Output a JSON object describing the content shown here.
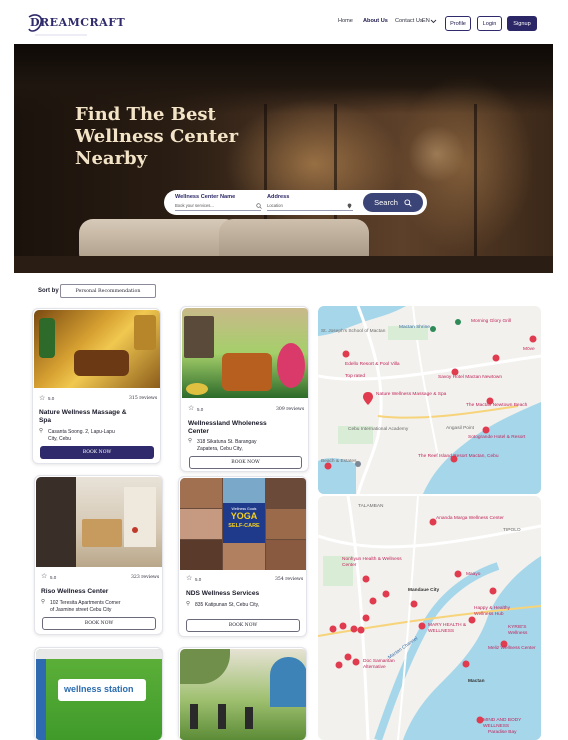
{
  "brand": {
    "name": "DREAMCRAFT"
  },
  "nav": {
    "home": "Home",
    "about": "About Us",
    "contact": "Contact Us",
    "lang": "EN"
  },
  "auth": {
    "profile": "Profile",
    "login": "Login",
    "signup": "Signup"
  },
  "hero": {
    "title_line1": "Find The Best",
    "title_line2": "Wellness Center",
    "title_line3": "Nearby"
  },
  "search": {
    "name_label": "Wellness Center Name",
    "name_placeholder": "Book your services...",
    "address_label": "Address",
    "address_placeholder": "Location",
    "button": "Search"
  },
  "sort": {
    "label": "Sort by",
    "value": "Personal Recommendation"
  },
  "cards": [
    {
      "rating": "5.0",
      "reviews": "315 reviews",
      "name_l1": "Nature Wellness Massage &",
      "name_l2": "Spa",
      "addr_l1": "Casanta Soong. 2, Lapu-Lapu",
      "addr_l2": "City, Cebu",
      "book": "BOOK NOW"
    },
    {
      "rating": "5.0",
      "reviews": "309 reviews",
      "name_l1": "Wellnessland Wholeness",
      "name_l2": "Center",
      "addr_l1": "318 Sikatuna St. Barangay",
      "addr_l2": "Zapatera, Cebu City,",
      "book": "BOOK NOW"
    },
    {
      "rating": "5.0",
      "reviews": "323 reviews",
      "name_l1": "Riso Wellness Center",
      "name_l2": "",
      "addr_l1": "102 Teresita Apartments Corner",
      "addr_l2": "of Jasmine street Cebu City",
      "book": "BOOK NOW"
    },
    {
      "rating": "5.0",
      "reviews": "354 reviews",
      "name_l1": "NDS Wellness Services",
      "name_l2": "",
      "addr_l1": "835 Katipunan St, Cebu City,",
      "addr_l2": "",
      "book": "BOOK NOW"
    }
  ],
  "images": {
    "nds_tag": "Wellness Goals",
    "nds_yoga": "YOGA",
    "nds_selfcare": "SELF-CARE",
    "station_sign": "wellness station"
  },
  "map1": {
    "labels": [
      "Mactan Shrine",
      "Morning Glory Grill",
      "St. Joseph's School of Mactan",
      "Edello Resort & Pool Villa",
      "Top rated",
      "Savoy Hotel Mactan Newtown",
      "Nature Wellness Massage & Spa",
      "The Mactan Newtown Beach",
      "Cebu International Academy",
      "Angasil Point",
      "Sotogrande Hotel & Resort",
      "The Reef Island Resort Mactan, Cebu",
      "Beach & Estates",
      "Möve"
    ]
  },
  "map2": {
    "labels": [
      "Ananda Marga Wellness Center",
      "Nonhyun Health & Wellness Center",
      "Maayo",
      "Mandaue City",
      "Happy & Healthy Wellness Hub",
      "MARY HEALTH & WELLNESS",
      "KYRIE'S Wellness",
      "Mactan Channel",
      "Doc Samaritan Alternative",
      "Mactan",
      "Meliz Wellness Center",
      "MIND AND BODY WELLNESS",
      "Paradise Bay",
      "TALAMBAN",
      "TIPOLO"
    ]
  },
  "colors": {
    "brand": "#2e2a6b",
    "search_button": "#3b4476",
    "map_water": "#a6d6ea",
    "map_land": "#f2f1ed",
    "pin": "#e03b4e"
  }
}
